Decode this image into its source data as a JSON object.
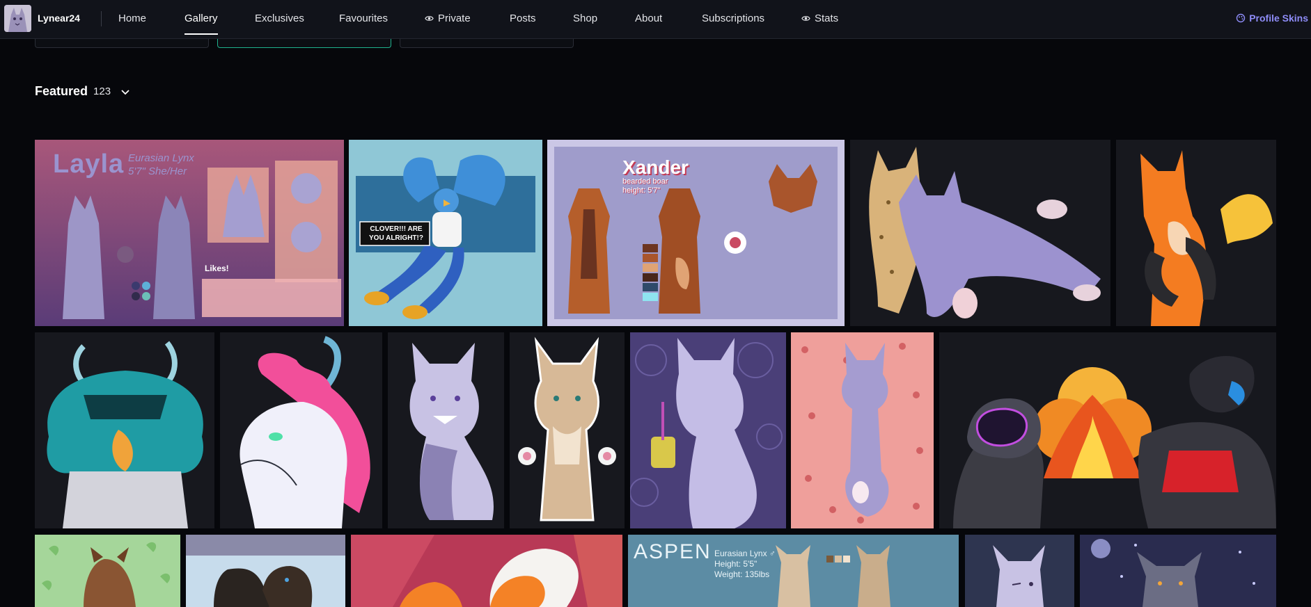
{
  "profile": {
    "username": "Lynear24"
  },
  "nav": {
    "items": [
      {
        "label": "Home"
      },
      {
        "label": "Gallery"
      },
      {
        "label": "Exclusives"
      },
      {
        "label": "Favourites"
      },
      {
        "label": "Private"
      },
      {
        "label": "Posts"
      },
      {
        "label": "Shop"
      },
      {
        "label": "About"
      },
      {
        "label": "Subscriptions"
      },
      {
        "label": "Stats"
      }
    ],
    "active": "Gallery",
    "profile_skins": "Profile Skins"
  },
  "section": {
    "title": "Featured",
    "count": "123"
  },
  "tiles": {
    "layla": {
      "name": "Layla",
      "species": "Eurasian Lynx",
      "line2": "5'7\" She/Her",
      "likes": "Likes!",
      "colors": [
        "#c05a7d",
        "#e9a79a",
        "#8f8fc8"
      ]
    },
    "clover": {
      "speech": "CLOVER!!! ARE YOU ALRIGHT!?"
    },
    "xander": {
      "name": "Xander",
      "sub1": "bearded boar",
      "sub2": "height: 5'7\""
    },
    "aspen": {
      "name": "ASPEN",
      "species": "Eurasian Lynx ♂",
      "height": "Height: 5'5\"",
      "weight": "Weight: 135lbs"
    }
  },
  "colors": {
    "background": "#06070b",
    "topbar": "#11131a",
    "accent_teal": "#1fb28d",
    "skins_purple": "#8e8cf7"
  }
}
